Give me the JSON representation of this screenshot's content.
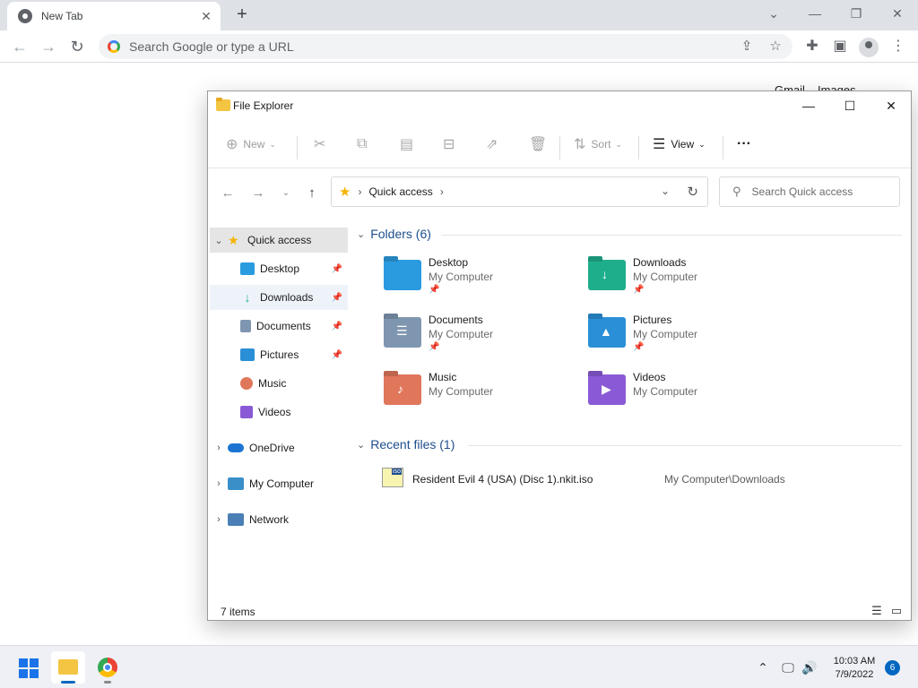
{
  "chrome": {
    "tab_title": "New Tab",
    "tab_close": "✕",
    "new_tab": "+",
    "omnibox_placeholder": "Search Google or type a URL",
    "links": {
      "gmail": "Gmail",
      "images": "Images"
    }
  },
  "explorer": {
    "title": "File Explorer",
    "toolbar": {
      "new_label": "New",
      "sort_label": "Sort",
      "view_label": "View",
      "more": "···"
    },
    "address": {
      "crumb": "Quick access",
      "search_placeholder": "Search Quick access"
    },
    "nav": [
      {
        "label": "Quick access",
        "expander": "⌄"
      },
      {
        "label": "Desktop"
      },
      {
        "label": "Downloads"
      },
      {
        "label": "Documents"
      },
      {
        "label": "Pictures"
      },
      {
        "label": "Music"
      },
      {
        "label": "Videos"
      },
      {
        "label": "OneDrive",
        "expander": "›"
      },
      {
        "label": "My Computer",
        "expander": "›"
      },
      {
        "label": "Network",
        "expander": "›"
      }
    ],
    "folders_header": "Folders (6)",
    "folders": [
      {
        "name": "Desktop",
        "location": "My Computer",
        "pinned": true,
        "color": "#2b9be0"
      },
      {
        "name": "Downloads",
        "location": "My Computer",
        "pinned": true,
        "color": "#1fae8c"
      },
      {
        "name": "Documents",
        "location": "My Computer",
        "pinned": true,
        "color": "#7f96b0"
      },
      {
        "name": "Pictures",
        "location": "My Computer",
        "pinned": true,
        "color": "#2a8fd6"
      },
      {
        "name": "Music",
        "location": "My Computer",
        "pinned": false,
        "color": "#e0775b"
      },
      {
        "name": "Videos",
        "location": "My Computer",
        "pinned": false,
        "color": "#8a5ad6"
      }
    ],
    "recent_header": "Recent files (1)",
    "recent": [
      {
        "name": "Resident Evil 4 (USA) (Disc 1).nkit.iso",
        "location": "My Computer\\Downloads"
      }
    ],
    "status": "7 items"
  },
  "taskbar": {
    "time": "10:03 AM",
    "date": "7/9/2022",
    "notifications": "6"
  },
  "colors": {
    "accent": "#0067c0",
    "header_blue": "#1e4e8c"
  }
}
